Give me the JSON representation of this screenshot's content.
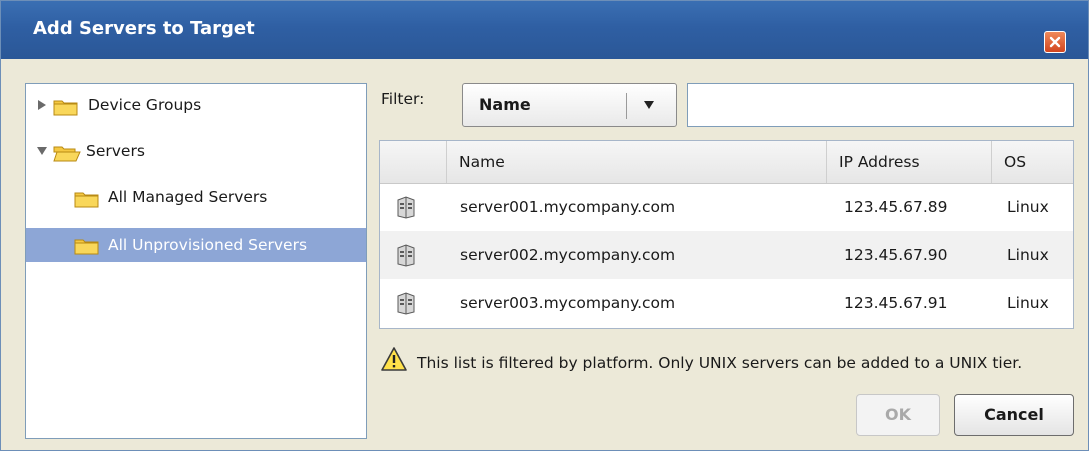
{
  "dialog": {
    "title": "Add Servers to Target"
  },
  "tree": {
    "items": [
      {
        "label": "Device Groups",
        "expanded": false,
        "selected": false,
        "icon": "folder-icon"
      },
      {
        "label": "Servers",
        "expanded": true,
        "selected": false,
        "icon": "open-folder-icon"
      },
      {
        "label": "All Managed Servers",
        "selected": false,
        "icon": "folder-icon"
      },
      {
        "label": "All Unprovisioned Servers",
        "selected": true,
        "icon": "folder-icon"
      }
    ]
  },
  "filter": {
    "label": "Filter:",
    "selected_option": "Name",
    "text_value": ""
  },
  "table": {
    "columns": [
      "",
      "Name",
      "IP Address",
      "OS"
    ],
    "rows": [
      {
        "icon": "server-icon",
        "name": "server001.mycompany.com",
        "ip": "123.45.67.89",
        "os": "Linux"
      },
      {
        "icon": "server-icon",
        "name": "server002.mycompany.com",
        "ip": "123.45.67.90",
        "os": "Linux"
      },
      {
        "icon": "server-icon",
        "name": "server003.mycompany.com",
        "ip": "123.45.67.91",
        "os": "Linux"
      }
    ]
  },
  "warning": {
    "icon": "warning-icon",
    "text": "This list is filtered by platform. Only UNIX servers can be added to a UNIX tier."
  },
  "buttons": {
    "ok": "OK",
    "cancel": "Cancel",
    "ok_enabled": false
  },
  "colors": {
    "titlebar": "#2f5fa3",
    "selection": "#8da6d6",
    "close": "#d2451e"
  }
}
